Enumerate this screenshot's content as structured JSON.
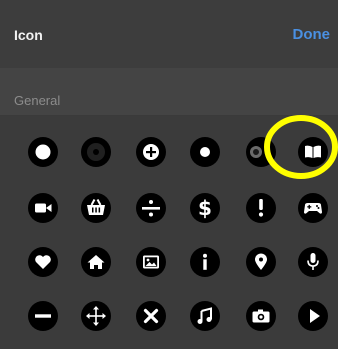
{
  "header": {
    "title": "Icon",
    "done_label": "Done"
  },
  "section": {
    "label": "General"
  },
  "colors": {
    "panel": "#3a3a3a",
    "accent": "#4a90e2",
    "icon_bg": "#000000",
    "icon_fg": "#ffffff",
    "highlight_ring": "#ffff00"
  },
  "icons": [
    [
      "circle-filled-icon",
      "record-icon",
      "plus-circle-icon",
      "small-dot-icon",
      "toggle-dot-icon",
      "book-icon"
    ],
    [
      "video-camera-icon",
      "shopping-basket-icon",
      "divide-icon",
      "dollar-icon",
      "exclamation-icon",
      "gamepad-icon"
    ],
    [
      "heart-icon",
      "home-icon",
      "image-icon",
      "info-icon",
      "location-pin-icon",
      "microphone-icon"
    ],
    [
      "minus-icon",
      "move-arrows-icon",
      "close-x-icon",
      "music-note-icon",
      "camera-icon",
      "play-icon"
    ]
  ],
  "selected_icon": "book-icon"
}
